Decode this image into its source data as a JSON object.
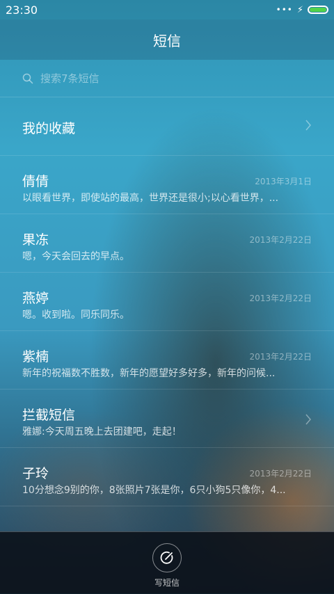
{
  "status_bar": {
    "time": "23:30",
    "signal_dots": "•••",
    "charging_icon": "⚡",
    "battery_level": 1.0,
    "battery_color": "#52d24a"
  },
  "header": {
    "title": "短信"
  },
  "search": {
    "placeholder": "搜索7条短信"
  },
  "list": {
    "favorites": {
      "label": "我的收藏"
    },
    "conversations": [
      {
        "name": "倩倩",
        "date": "2013年3月1日",
        "snippet": "以眼看世界，即使站的最高，世界还是很小;以心看世界，..."
      },
      {
        "name": "果冻",
        "date": "2013年2月22日",
        "snippet": "嗯，今天会回去的早点。"
      },
      {
        "name": "燕婷",
        "date": "2013年2月22日",
        "snippet": "嗯。收到啦。同乐同乐。"
      },
      {
        "name": "紫楠",
        "date": "2013年2月22日",
        "snippet": "新年的祝福数不胜数，新年的愿望好多好多，新年的问候..."
      }
    ],
    "intercept": {
      "name": "拦截短信",
      "snippet": "雅娜:今天周五晚上去团建吧，走起！"
    },
    "conversations_after": [
      {
        "name": "子玲",
        "date": "2013年2月22日",
        "snippet": "10分想念9别的你，8张照片7张是你，6只小狗5只像你，4..."
      }
    ]
  },
  "bottom": {
    "compose_label": "写短信"
  }
}
